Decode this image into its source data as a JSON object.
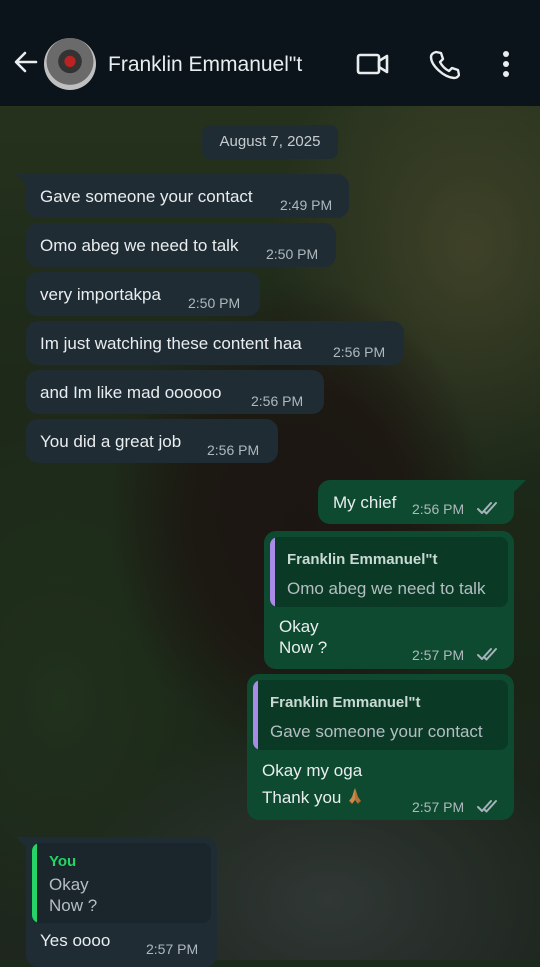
{
  "header": {
    "contact_name": "Franklin Emmanuel\"t",
    "back_icon": "arrow-left-icon",
    "video_icon": "video-call-icon",
    "call_icon": "phone-icon",
    "menu_icon": "more-vertical-icon"
  },
  "date_separator": "August 7, 2025",
  "incoming": [
    {
      "text": "Gave someone your contact",
      "time": "2:49 PM"
    },
    {
      "text": "Omo abeg we need to talk",
      "time": "2:50 PM"
    },
    {
      "text": "very importakpa",
      "time": "2:50 PM"
    },
    {
      "text": "Im just watching these content haa",
      "time": "2:56 PM"
    },
    {
      "text": "and Im like mad oooooo",
      "time": "2:56 PM"
    },
    {
      "text": "You did a great job",
      "time": "2:56 PM"
    }
  ],
  "outgoing": [
    {
      "text": "My chief",
      "time": "2:56 PM"
    },
    {
      "quote_name": "Franklin Emmanuel\"t",
      "quote_text": "Omo abeg we need to talk",
      "line1": "Okay",
      "line2": "Now ?",
      "time": "2:57 PM"
    },
    {
      "quote_name": "Franklin Emmanuel\"t",
      "quote_text": "Gave someone your contact",
      "line1": "Okay my oga",
      "line2": "Thank you",
      "emoji": "folded-hands-emoji",
      "time": "2:57 PM"
    }
  ],
  "last_incoming": {
    "quote_name": "You",
    "quote_line1": "Okay",
    "quote_line2": "Now ?",
    "text": "Yes oooo",
    "time": "2:57 PM"
  },
  "colors": {
    "incoming_bubble": "#1f2c34",
    "outgoing_bubble": "#0d4a30",
    "quote_bar_contact": "#a98ae6",
    "quote_bar_you": "#25d366",
    "read_ticks": "#a6b4ba"
  }
}
